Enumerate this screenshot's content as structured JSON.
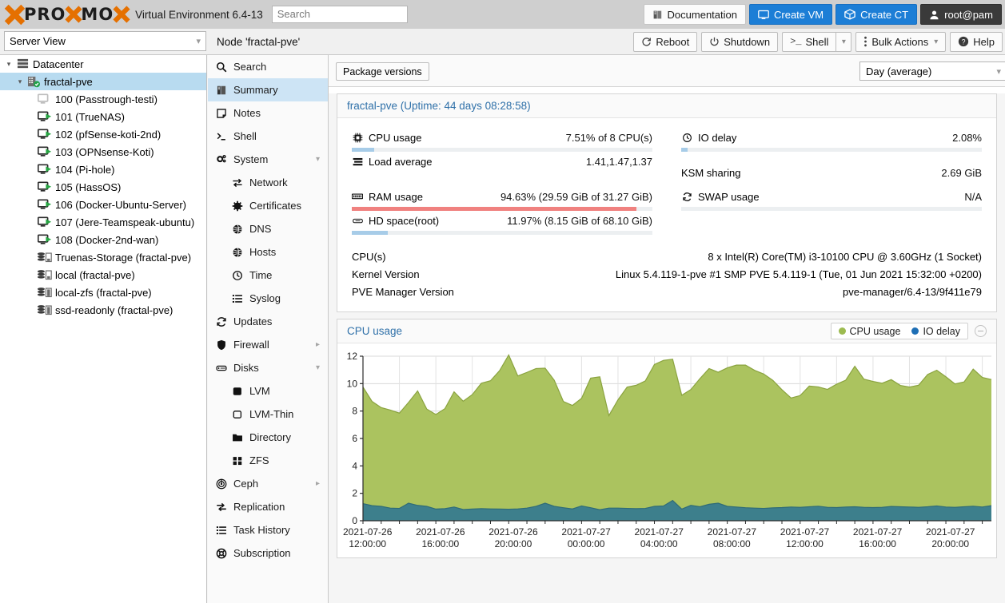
{
  "topbar": {
    "logo_words": [
      "PRO",
      "MO"
    ],
    "product_name": "Virtual Environment 6.4-13",
    "search_placeholder": "Search",
    "buttons": [
      {
        "id": "documentation",
        "label": "Documentation",
        "icon": "book-icon",
        "style": "light"
      },
      {
        "id": "create-vm",
        "label": "Create VM",
        "icon": "monitor-icon",
        "style": "blue"
      },
      {
        "id": "create-ct",
        "label": "Create CT",
        "icon": "box-icon",
        "style": "blue"
      },
      {
        "id": "user-menu",
        "label": "root@pam",
        "icon": "user-icon",
        "style": "dark"
      }
    ]
  },
  "secondbar": {
    "view_selector": "Server View",
    "node_title": "Node 'fractal-pve'",
    "buttons": [
      {
        "id": "reboot",
        "label": "Reboot",
        "icon": "reboot-icon",
        "split": false
      },
      {
        "id": "shutdown",
        "label": "Shutdown",
        "icon": "power-icon",
        "split": false
      },
      {
        "id": "shell",
        "label": "Shell",
        "icon": "terminal-icon",
        "split": true
      },
      {
        "id": "bulk-actions",
        "label": "Bulk Actions",
        "icon": "dots-vertical-icon",
        "split": false,
        "caret": true
      },
      {
        "id": "help",
        "label": "Help",
        "icon": "question-circle-icon",
        "split": false
      }
    ]
  },
  "tree": {
    "nodes": [
      {
        "label": "Datacenter",
        "depth": 0,
        "icon": "datacenter-icon",
        "expanded": true,
        "selected": false
      },
      {
        "label": "fractal-pve",
        "depth": 1,
        "icon": "node-ok-icon",
        "expanded": true,
        "selected": true
      },
      {
        "label": "100 (Passtrough-testi)",
        "depth": 2,
        "icon": "vm-stopped-icon",
        "selected": false
      },
      {
        "label": "101 (TrueNAS)",
        "depth": 2,
        "icon": "vm-running-icon",
        "selected": false
      },
      {
        "label": "102 (pfSense-koti-2nd)",
        "depth": 2,
        "icon": "vm-running-icon",
        "selected": false
      },
      {
        "label": "103 (OPNsense-Koti)",
        "depth": 2,
        "icon": "vm-running-icon",
        "selected": false
      },
      {
        "label": "104 (Pi-hole)",
        "depth": 2,
        "icon": "vm-running-icon",
        "selected": false
      },
      {
        "label": "105 (HassOS)",
        "depth": 2,
        "icon": "vm-running-icon",
        "selected": false
      },
      {
        "label": "106 (Docker-Ubuntu-Server)",
        "depth": 2,
        "icon": "vm-running-icon",
        "selected": false
      },
      {
        "label": "107 (Jere-Teamspeak-ubuntu)",
        "depth": 2,
        "icon": "vm-running-icon",
        "selected": false
      },
      {
        "label": "108 (Docker-2nd-wan)",
        "depth": 2,
        "icon": "vm-running-icon",
        "selected": false
      },
      {
        "label": "Truenas-Storage (fractal-pve)",
        "depth": 2,
        "icon": "storage-icon",
        "selected": false
      },
      {
        "label": "local (fractal-pve)",
        "depth": 2,
        "icon": "storage-icon",
        "selected": false
      },
      {
        "label": "local-zfs (fractal-pve)",
        "depth": 2,
        "icon": "storage-full-icon",
        "selected": false
      },
      {
        "label": "ssd-readonly (fractal-pve)",
        "depth": 2,
        "icon": "storage-full-icon",
        "selected": false
      }
    ]
  },
  "nav": {
    "items": [
      {
        "label": "Search",
        "icon": "search-icon",
        "sub": false,
        "selected": false
      },
      {
        "label": "Summary",
        "icon": "book-icon",
        "sub": false,
        "selected": true
      },
      {
        "label": "Notes",
        "icon": "note-icon",
        "sub": false,
        "selected": false
      },
      {
        "label": "Shell",
        "icon": "terminal-icon",
        "sub": false,
        "selected": false
      },
      {
        "label": "System",
        "icon": "gears-icon",
        "sub": false,
        "selected": false,
        "arrow": "down"
      },
      {
        "label": "Network",
        "icon": "network-icon",
        "sub": true,
        "selected": false
      },
      {
        "label": "Certificates",
        "icon": "certificate-icon",
        "sub": true,
        "selected": false
      },
      {
        "label": "DNS",
        "icon": "globe-icon",
        "sub": true,
        "selected": false
      },
      {
        "label": "Hosts",
        "icon": "globe-icon",
        "sub": true,
        "selected": false
      },
      {
        "label": "Time",
        "icon": "clock-icon",
        "sub": true,
        "selected": false
      },
      {
        "label": "Syslog",
        "icon": "list-icon",
        "sub": true,
        "selected": false
      },
      {
        "label": "Updates",
        "icon": "refresh-icon",
        "sub": false,
        "selected": false
      },
      {
        "label": "Firewall",
        "icon": "shield-icon",
        "sub": false,
        "selected": false,
        "arrow": "right"
      },
      {
        "label": "Disks",
        "icon": "disk-icon",
        "sub": false,
        "selected": false,
        "arrow": "down"
      },
      {
        "label": "LVM",
        "icon": "lvm-icon",
        "sub": true,
        "selected": false
      },
      {
        "label": "LVM-Thin",
        "icon": "lvmthin-icon",
        "sub": true,
        "selected": false
      },
      {
        "label": "Directory",
        "icon": "folder-icon",
        "sub": true,
        "selected": false
      },
      {
        "label": "ZFS",
        "icon": "zfs-icon",
        "sub": true,
        "selected": false
      },
      {
        "label": "Ceph",
        "icon": "ceph-icon",
        "sub": false,
        "selected": false,
        "arrow": "right"
      },
      {
        "label": "Replication",
        "icon": "replication-icon",
        "sub": false,
        "selected": false
      },
      {
        "label": "Task History",
        "icon": "list-icon",
        "sub": false,
        "selected": false
      },
      {
        "label": "Subscription",
        "icon": "lifebuoy-icon",
        "sub": false,
        "selected": false
      }
    ]
  },
  "content": {
    "package_versions_label": "Package versions",
    "range_selector": "Day (average)",
    "summary": {
      "title": "fractal-pve (Uptime: 44 days 08:28:58)",
      "left": [
        {
          "label": "CPU usage",
          "icon": "cpu-icon",
          "value": "7.51% of 8 CPU(s)",
          "bar": 7.51,
          "bar_style": "normal"
        },
        {
          "label": "Load average",
          "icon": "load-icon",
          "value": "1.41,1.47,1.37",
          "bar": null
        },
        {
          "label": "RAM usage",
          "icon": "ram-icon",
          "value": "94.63% (29.59 GiB of 31.27 GiB)",
          "bar": 94.63,
          "bar_style": "danger"
        },
        {
          "label": "HD space(root)",
          "icon": "hd-icon",
          "value": "11.97% (8.15 GiB of 68.10 GiB)",
          "bar": 11.97,
          "bar_style": "normal"
        }
      ],
      "right": [
        {
          "label": "IO delay",
          "icon": "clock-icon",
          "value": "2.08%",
          "bar": 2.08,
          "bar_style": "normal"
        },
        {
          "label": "KSM sharing",
          "icon": "none",
          "value": "2.69 GiB",
          "bar": null
        },
        {
          "label": "SWAP usage",
          "icon": "swap-icon",
          "value": "N/A",
          "bar": 0,
          "bar_style": "normal"
        }
      ],
      "info": [
        {
          "label": "CPU(s)",
          "value": "8 x Intel(R) Core(TM) i3-10100 CPU @ 3.60GHz (1 Socket)"
        },
        {
          "label": "Kernel Version",
          "value": "Linux 5.4.119-1-pve #1 SMP PVE 5.4.119-1 (Tue, 01 Jun 2021 15:32:00 +0200)"
        },
        {
          "label": "PVE Manager Version",
          "value": "pve-manager/6.4-13/9f411e79"
        }
      ]
    },
    "chart_card": {
      "title": "CPU usage",
      "legend": [
        {
          "label": "CPU usage",
          "color": "#9dbb51"
        },
        {
          "label": "IO delay",
          "color": "#1f6fb5"
        }
      ]
    }
  },
  "chart_data": {
    "type": "area",
    "title": "CPU usage",
    "xlabel": "",
    "ylabel": "",
    "ylim": [
      0,
      12
    ],
    "yticks": [
      0,
      2,
      4,
      6,
      8,
      10,
      12
    ],
    "grid": true,
    "legend_position": "top-right",
    "stacked": true,
    "xtick_labels": [
      "2021-07-26 12:00:00",
      "2021-07-26 16:00:00",
      "2021-07-26 20:00:00",
      "2021-07-27 00:00:00",
      "2021-07-27 04:00:00",
      "2021-07-27 08:00:00",
      "2021-07-27 12:00:00",
      "2021-07-27 16:00:00",
      "2021-07-27 20:00:00"
    ],
    "xtick_positions": [
      0.5,
      8.5,
      16.5,
      24.5,
      32.5,
      40.5,
      48.5,
      56.5,
      64.5
    ],
    "n_points": 70,
    "series": [
      {
        "name": "IO delay",
        "color": "#3d7f8c",
        "values": [
          1.25,
          1.1,
          1.05,
          0.92,
          0.9,
          1.28,
          1.12,
          1.05,
          0.85,
          0.88,
          1.0,
          0.82,
          0.85,
          0.88,
          0.86,
          0.85,
          0.84,
          0.86,
          0.92,
          1.05,
          1.28,
          1.05,
          0.95,
          0.86,
          1.08,
          0.95,
          0.8,
          0.92,
          0.92,
          0.9,
          0.88,
          0.9,
          1.05,
          1.08,
          1.48,
          0.85,
          1.12,
          1.02,
          1.2,
          1.28,
          1.05,
          1.0,
          0.95,
          0.92,
          0.9,
          0.94,
          0.96,
          1.0,
          0.98,
          1.02,
          1.06,
          0.98,
          0.96,
          1.0,
          1.02,
          0.98,
          0.96,
          0.98,
          1.04,
          1.02,
          1.0,
          0.98,
          1.02,
          1.08,
          1.0,
          0.98,
          1.02,
          1.06,
          1.0,
          1.1
        ]
      },
      {
        "name": "CPU usage",
        "color": "#abc35f",
        "values": [
          8.5,
          7.6,
          7.2,
          7.15,
          6.95,
          7.35,
          8.35,
          7.1,
          6.9,
          7.3,
          8.4,
          7.9,
          8.35,
          9.15,
          9.35,
          10.1,
          11.25,
          9.7,
          9.9,
          10.05,
          9.85,
          9.2,
          7.75,
          7.55,
          7.85,
          9.45,
          9.7,
          6.75,
          7.9,
          8.85,
          9.0,
          9.3,
          10.35,
          10.62,
          10.3,
          8.3,
          8.45,
          9.35,
          9.9,
          9.55,
          10.1,
          10.35,
          10.4,
          10.05,
          9.8,
          9.3,
          8.6,
          7.95,
          8.15,
          8.8,
          8.7,
          8.6,
          9.0,
          9.25,
          10.25,
          9.35,
          9.2,
          9.05,
          9.25,
          8.85,
          8.75,
          8.9,
          9.65,
          9.9,
          9.5,
          9.0,
          9.1,
          10.0,
          9.45,
          9.2
        ]
      }
    ]
  }
}
